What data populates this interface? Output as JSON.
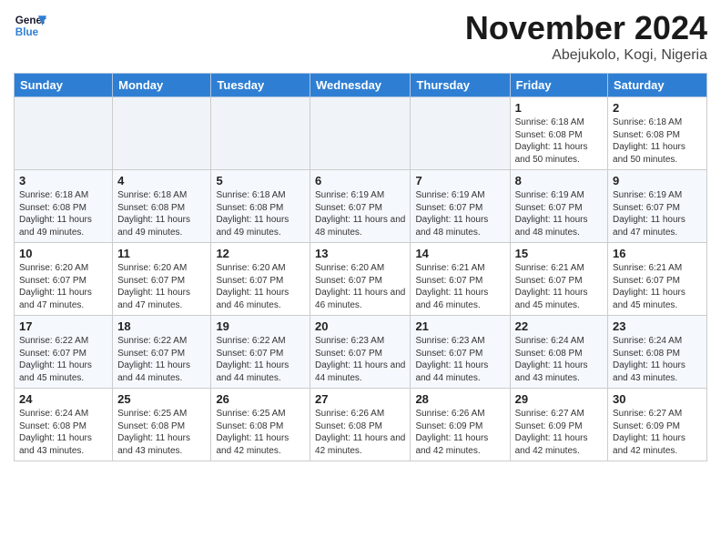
{
  "logo": {
    "general": "General",
    "blue": "Blue"
  },
  "title": "November 2024",
  "location": "Abejukolo, Kogi, Nigeria",
  "weekdays": [
    "Sunday",
    "Monday",
    "Tuesday",
    "Wednesday",
    "Thursday",
    "Friday",
    "Saturday"
  ],
  "weeks": [
    [
      {
        "day": "",
        "info": ""
      },
      {
        "day": "",
        "info": ""
      },
      {
        "day": "",
        "info": ""
      },
      {
        "day": "",
        "info": ""
      },
      {
        "day": "",
        "info": ""
      },
      {
        "day": "1",
        "info": "Sunrise: 6:18 AM\nSunset: 6:08 PM\nDaylight: 11 hours and 50 minutes."
      },
      {
        "day": "2",
        "info": "Sunrise: 6:18 AM\nSunset: 6:08 PM\nDaylight: 11 hours and 50 minutes."
      }
    ],
    [
      {
        "day": "3",
        "info": "Sunrise: 6:18 AM\nSunset: 6:08 PM\nDaylight: 11 hours and 49 minutes."
      },
      {
        "day": "4",
        "info": "Sunrise: 6:18 AM\nSunset: 6:08 PM\nDaylight: 11 hours and 49 minutes."
      },
      {
        "day": "5",
        "info": "Sunrise: 6:18 AM\nSunset: 6:08 PM\nDaylight: 11 hours and 49 minutes."
      },
      {
        "day": "6",
        "info": "Sunrise: 6:19 AM\nSunset: 6:07 PM\nDaylight: 11 hours and 48 minutes."
      },
      {
        "day": "7",
        "info": "Sunrise: 6:19 AM\nSunset: 6:07 PM\nDaylight: 11 hours and 48 minutes."
      },
      {
        "day": "8",
        "info": "Sunrise: 6:19 AM\nSunset: 6:07 PM\nDaylight: 11 hours and 48 minutes."
      },
      {
        "day": "9",
        "info": "Sunrise: 6:19 AM\nSunset: 6:07 PM\nDaylight: 11 hours and 47 minutes."
      }
    ],
    [
      {
        "day": "10",
        "info": "Sunrise: 6:20 AM\nSunset: 6:07 PM\nDaylight: 11 hours and 47 minutes."
      },
      {
        "day": "11",
        "info": "Sunrise: 6:20 AM\nSunset: 6:07 PM\nDaylight: 11 hours and 47 minutes."
      },
      {
        "day": "12",
        "info": "Sunrise: 6:20 AM\nSunset: 6:07 PM\nDaylight: 11 hours and 46 minutes."
      },
      {
        "day": "13",
        "info": "Sunrise: 6:20 AM\nSunset: 6:07 PM\nDaylight: 11 hours and 46 minutes."
      },
      {
        "day": "14",
        "info": "Sunrise: 6:21 AM\nSunset: 6:07 PM\nDaylight: 11 hours and 46 minutes."
      },
      {
        "day": "15",
        "info": "Sunrise: 6:21 AM\nSunset: 6:07 PM\nDaylight: 11 hours and 45 minutes."
      },
      {
        "day": "16",
        "info": "Sunrise: 6:21 AM\nSunset: 6:07 PM\nDaylight: 11 hours and 45 minutes."
      }
    ],
    [
      {
        "day": "17",
        "info": "Sunrise: 6:22 AM\nSunset: 6:07 PM\nDaylight: 11 hours and 45 minutes."
      },
      {
        "day": "18",
        "info": "Sunrise: 6:22 AM\nSunset: 6:07 PM\nDaylight: 11 hours and 44 minutes."
      },
      {
        "day": "19",
        "info": "Sunrise: 6:22 AM\nSunset: 6:07 PM\nDaylight: 11 hours and 44 minutes."
      },
      {
        "day": "20",
        "info": "Sunrise: 6:23 AM\nSunset: 6:07 PM\nDaylight: 11 hours and 44 minutes."
      },
      {
        "day": "21",
        "info": "Sunrise: 6:23 AM\nSunset: 6:07 PM\nDaylight: 11 hours and 44 minutes."
      },
      {
        "day": "22",
        "info": "Sunrise: 6:24 AM\nSunset: 6:08 PM\nDaylight: 11 hours and 43 minutes."
      },
      {
        "day": "23",
        "info": "Sunrise: 6:24 AM\nSunset: 6:08 PM\nDaylight: 11 hours and 43 minutes."
      }
    ],
    [
      {
        "day": "24",
        "info": "Sunrise: 6:24 AM\nSunset: 6:08 PM\nDaylight: 11 hours and 43 minutes."
      },
      {
        "day": "25",
        "info": "Sunrise: 6:25 AM\nSunset: 6:08 PM\nDaylight: 11 hours and 43 minutes."
      },
      {
        "day": "26",
        "info": "Sunrise: 6:25 AM\nSunset: 6:08 PM\nDaylight: 11 hours and 42 minutes."
      },
      {
        "day": "27",
        "info": "Sunrise: 6:26 AM\nSunset: 6:08 PM\nDaylight: 11 hours and 42 minutes."
      },
      {
        "day": "28",
        "info": "Sunrise: 6:26 AM\nSunset: 6:09 PM\nDaylight: 11 hours and 42 minutes."
      },
      {
        "day": "29",
        "info": "Sunrise: 6:27 AM\nSunset: 6:09 PM\nDaylight: 11 hours and 42 minutes."
      },
      {
        "day": "30",
        "info": "Sunrise: 6:27 AM\nSunset: 6:09 PM\nDaylight: 11 hours and 42 minutes."
      }
    ]
  ]
}
